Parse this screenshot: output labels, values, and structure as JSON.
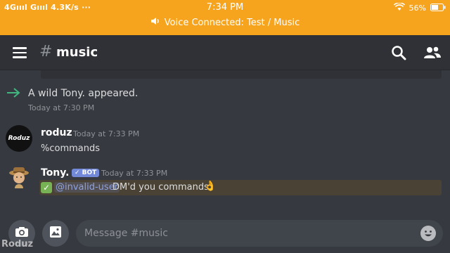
{
  "status_bar": {
    "left": "4Gıııl Gıııl 4.3K/s ···",
    "time": "7:34 PM",
    "battery": "56%",
    "voice_connected": "Voice Connected: Test / Music"
  },
  "header": {
    "hash": "#",
    "channel": "music"
  },
  "messages": [
    {
      "type": "system",
      "text": "A wild Tony. appeared.",
      "time": "Today at 7:30 PM"
    },
    {
      "type": "user",
      "author": "roduz",
      "avatar_text": "Roduz",
      "time": "Today at 7:33 PM",
      "text": "%commands"
    },
    {
      "type": "bot",
      "author": "Tony.",
      "bot_tag": "✓ BOT",
      "time": "Today at 7:33 PM",
      "mention": "@invalid-user",
      "text": "DM'd you commands",
      "emoji": "👌"
    }
  ],
  "composer": {
    "placeholder": "Message #music"
  },
  "watermark": "Roduz",
  "colors": {
    "status_bar": "#f6a41e",
    "background": "#36393f",
    "header": "#2f3136",
    "mention": "#8ea1e1",
    "bot_tag": "#7289da",
    "arrow": "#43b581"
  },
  "icons": [
    "menu-icon",
    "search-icon",
    "members-icon",
    "camera-icon",
    "image-icon",
    "emoji-icon",
    "speaker-icon",
    "wifi-icon",
    "battery-icon"
  ]
}
